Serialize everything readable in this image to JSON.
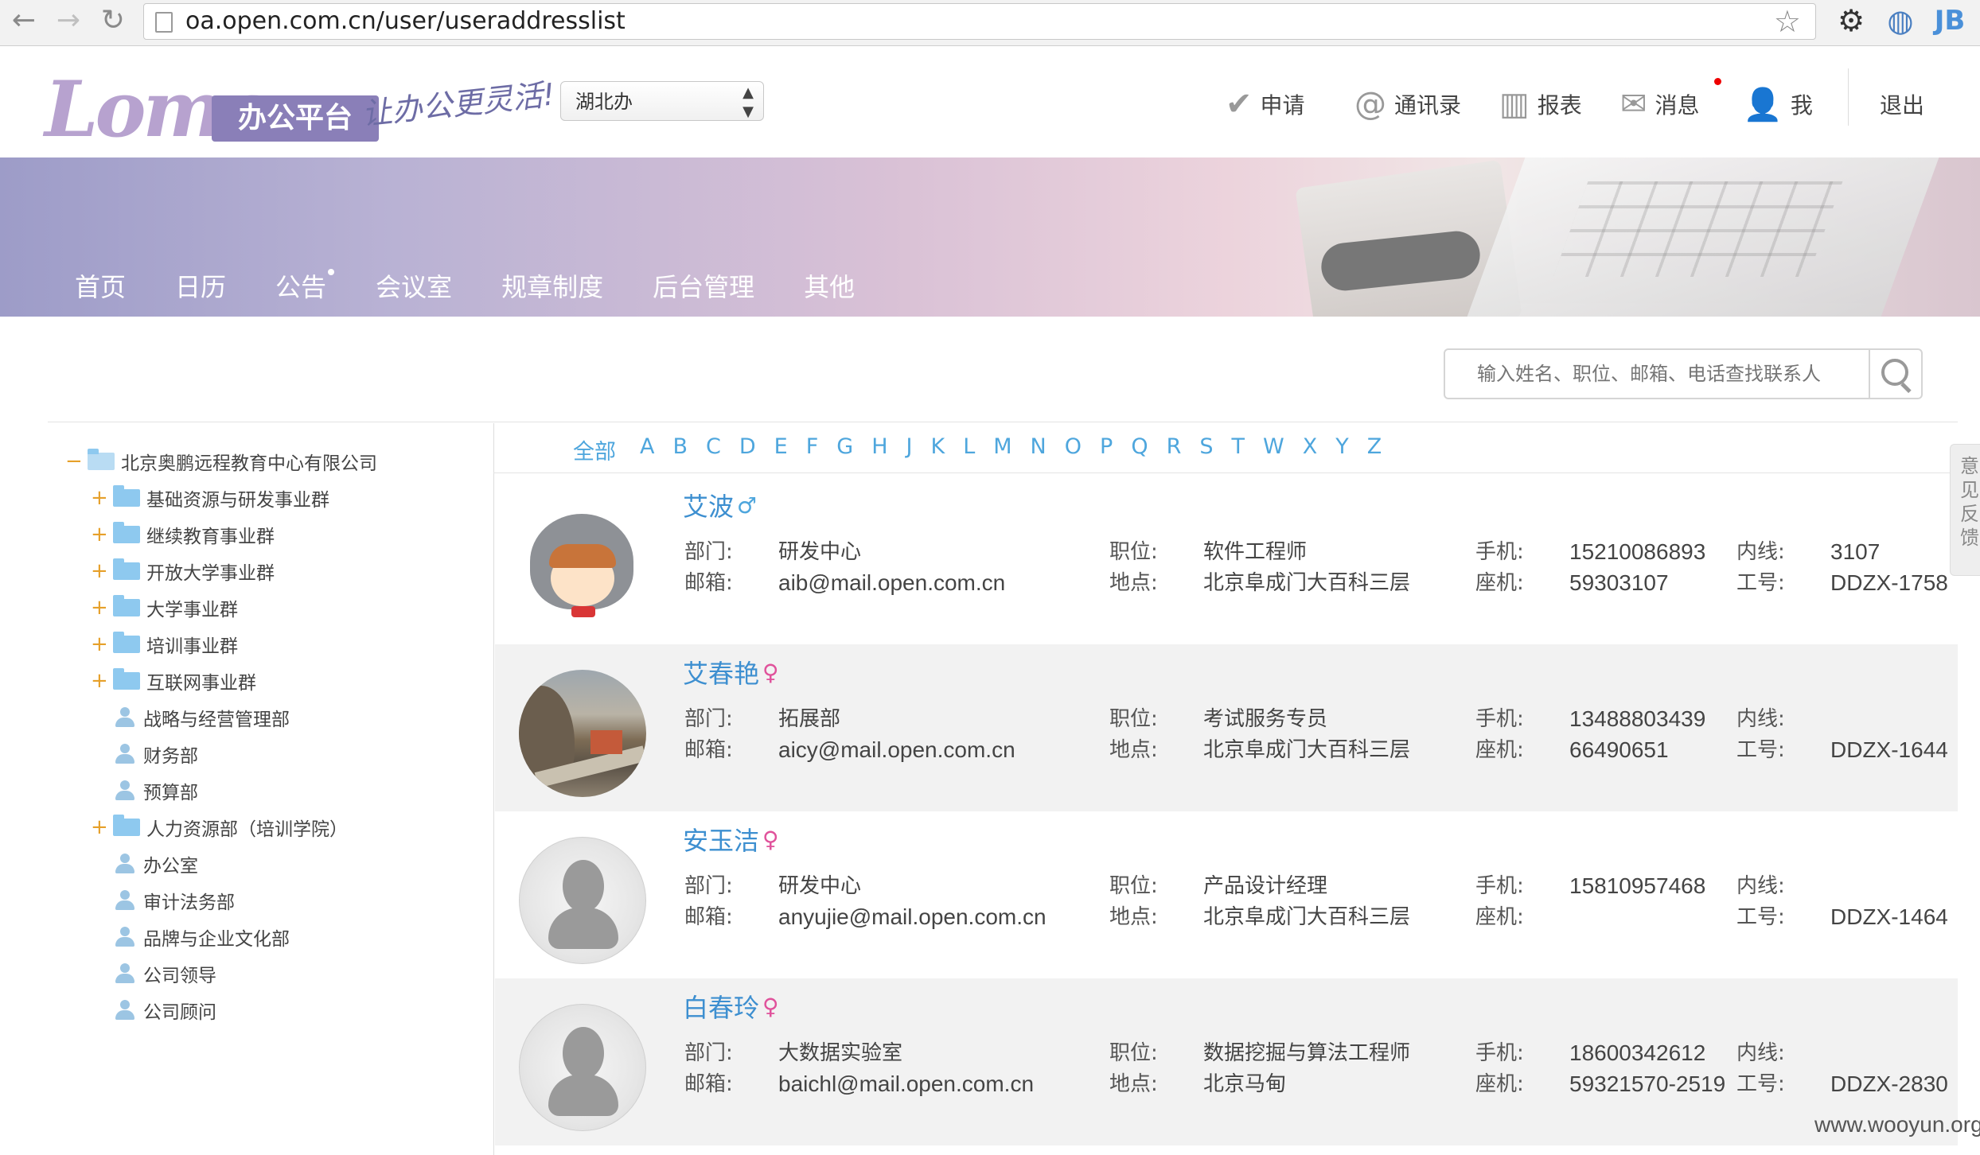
{
  "browser": {
    "url": "oa.open.com.cn/user/useraddresslist"
  },
  "header": {
    "logo_word": "Loma",
    "logo_badge": "办公平台",
    "slogan": "让办公更灵活!",
    "office_select": "湖北办",
    "topnav": [
      {
        "label": "申请",
        "icon": "check-circle-icon"
      },
      {
        "label": "通讯录",
        "icon": "at-icon"
      },
      {
        "label": "报表",
        "icon": "bar-chart-icon"
      },
      {
        "label": "消息",
        "icon": "mail-icon",
        "has_dot": true
      },
      {
        "label": "我",
        "icon": "user-icon"
      }
    ],
    "logout": "退出"
  },
  "mainnav": [
    "首页",
    "日历",
    "公告",
    "会议室",
    "规章制度",
    "后台管理",
    "其他"
  ],
  "search": {
    "placeholder": "输入姓名、职位、邮箱、电话查找联系人"
  },
  "tree": {
    "root": "北京奥鹏远程教育中心有限公司",
    "nodes": [
      {
        "label": "基础资源与研发事业群",
        "type": "folder"
      },
      {
        "label": "继续教育事业群",
        "type": "folder"
      },
      {
        "label": "开放大学事业群",
        "type": "folder"
      },
      {
        "label": "大学事业群",
        "type": "folder"
      },
      {
        "label": "培训事业群",
        "type": "folder"
      },
      {
        "label": "互联网事业群",
        "type": "folder"
      },
      {
        "label": "战略与经营管理部",
        "type": "group"
      },
      {
        "label": "财务部",
        "type": "group"
      },
      {
        "label": "预算部",
        "type": "group"
      },
      {
        "label": "人力资源部（培训学院）",
        "type": "folder"
      },
      {
        "label": "办公室",
        "type": "group"
      },
      {
        "label": "审计法务部",
        "type": "group"
      },
      {
        "label": "品牌与企业文化部",
        "type": "group"
      },
      {
        "label": "公司领导",
        "type": "group"
      },
      {
        "label": "公司顾问",
        "type": "group"
      }
    ]
  },
  "alphabet": [
    "全部",
    "A",
    "B",
    "C",
    "D",
    "E",
    "F",
    "G",
    "H",
    "J",
    "K",
    "L",
    "M",
    "N",
    "O",
    "P",
    "Q",
    "R",
    "S",
    "T",
    "W",
    "X",
    "Y",
    "Z"
  ],
  "labels": {
    "dept": "部门:",
    "position": "职位:",
    "mobile": "手机:",
    "ext": "内线:",
    "email": "邮箱:",
    "location": "地点:",
    "landline": "座机:",
    "empno": "工号:"
  },
  "contacts": [
    {
      "name": "艾波",
      "gender": "♂",
      "avatar": "cartoon",
      "dept": "研发中心",
      "position": "软件工程师",
      "mobile": "15210086893",
      "ext": "3107",
      "email": "aib@mail.open.com.cn",
      "location": "北京阜成门大百科三层",
      "landline": "59303107",
      "empno": "DDZX-1758"
    },
    {
      "name": "艾春艳",
      "gender": "♀",
      "avatar": "photo",
      "dept": "拓展部",
      "position": "考试服务专员",
      "mobile": "13488803439",
      "ext": "",
      "email": "aicy@mail.open.com.cn",
      "location": "北京阜成门大百科三层",
      "landline": "66490651",
      "empno": "DDZX-1644"
    },
    {
      "name": "安玉洁",
      "gender": "♀",
      "avatar": "blank",
      "dept": "研发中心",
      "position": "产品设计经理",
      "mobile": "15810957468",
      "ext": "",
      "email": "anyujie@mail.open.com.cn",
      "location": "北京阜成门大百科三层",
      "landline": "",
      "empno": "DDZX-1464"
    },
    {
      "name": "白春玲",
      "gender": "♀",
      "avatar": "blank",
      "dept": "大数据实验室",
      "position": "数据挖掘与算法工程师",
      "mobile": "18600342612",
      "ext": "",
      "email": "baichl@mail.open.com.cn",
      "location": "北京马甸",
      "landline": "59321570-2519",
      "empno": "DDZX-2830"
    }
  ],
  "sidetab": "意见反馈",
  "watermark": "www.wooyun.org"
}
